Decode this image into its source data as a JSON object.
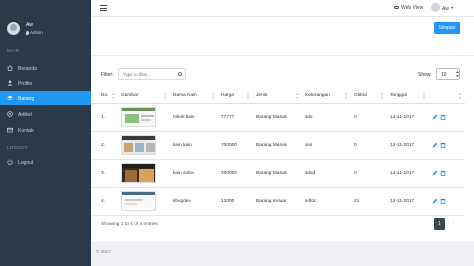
{
  "profile": {
    "name": "Aw",
    "role": "Admin"
  },
  "sidebar": {
    "section_main": "MAIN",
    "items": [
      {
        "label": "Beranda",
        "icon": "home-icon"
      },
      {
        "label": "Profile",
        "icon": "user-icon"
      },
      {
        "label": "Barang",
        "icon": "layers-icon",
        "active": true
      },
      {
        "label": "Artikel",
        "icon": "target-icon"
      },
      {
        "label": "Kontak",
        "icon": "mail-icon"
      }
    ],
    "section_logout": "LOGOUT",
    "logout_label": "Logout"
  },
  "topbar": {
    "web_view": "Web View",
    "user": "Aw"
  },
  "toolbar": {
    "simpan": "Simpan"
  },
  "filter": {
    "label": "Filter:",
    "placeholder": "Type to filter..."
  },
  "show": {
    "label": "Show",
    "value": "10"
  },
  "table": {
    "headers": [
      "No.",
      "Gambar",
      "Nama Kain",
      "Harga",
      "Jenis",
      "Keterangan",
      "Oldrid",
      "Tanggal"
    ],
    "rows": [
      {
        "no": "1.",
        "nama": "tokok kain",
        "harga": "77777",
        "jenis": "Barang Masuk",
        "ket": "sds",
        "oldrid": "0",
        "tanggal": "14-11-2017"
      },
      {
        "no": "2.",
        "nama": "kain kain",
        "harga": "700000",
        "jenis": "Barang Masuk",
        "ket": "sss",
        "oldrid": "0",
        "tanggal": "14-11-2017"
      },
      {
        "no": "3.",
        "nama": "kain sutra",
        "harga": "200000",
        "jenis": "Barang Masuk",
        "ket": "sdsd",
        "oldrid": "0",
        "tanggal": "14-11-2017"
      },
      {
        "no": "4.",
        "nama": "kbvgdev",
        "harga": "12000",
        "jenis": "Barang Keluar",
        "ket": "sdfdc",
        "oldrid": "21",
        "tanggal": "14-11-2017"
      }
    ]
  },
  "footer": {
    "info": "Showing 1 to 4 of 4 entries",
    "page": "1",
    "next": "›",
    "copyright": "© 2017"
  },
  "colors": {
    "accent": "#2196f3",
    "sidebar": "#2b3a4a",
    "edit": "#1e88e5",
    "delete": "#1e88e5"
  }
}
